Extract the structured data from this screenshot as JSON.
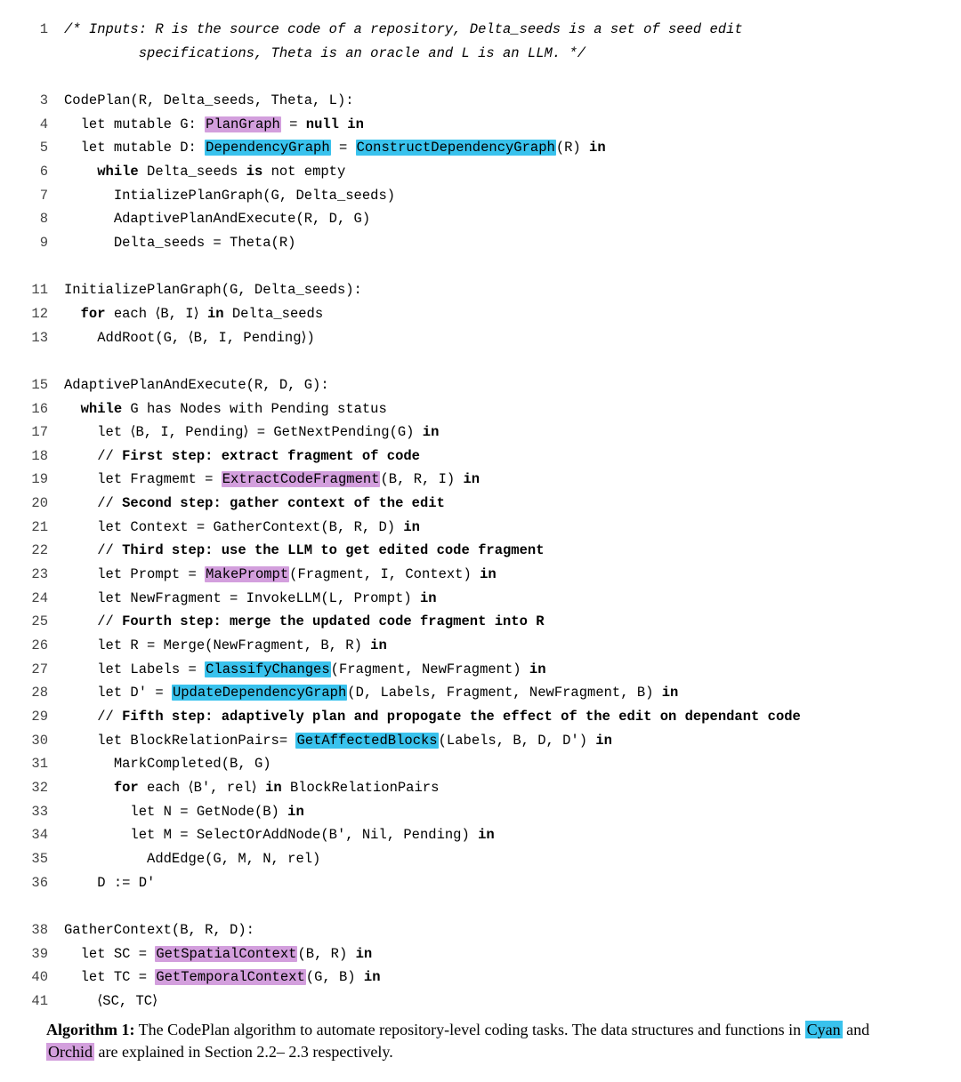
{
  "lines": [
    {
      "n": "1",
      "frags": [
        {
          "cls": "comment-ital",
          "t": "/* Inputs: R is the source code of a repository, Delta_seeds is a set of seed edit"
        }
      ]
    },
    {
      "n": "",
      "pad": "         ",
      "frags": [
        {
          "cls": "comment-ital",
          "t": "specifications, Theta is an oracle and L is an LLM. */"
        }
      ]
    },
    {
      "n": "",
      "frags": []
    },
    {
      "n": "3",
      "frags": [
        {
          "t": "CodePlan(R, Delta_seeds, Theta, L):"
        }
      ]
    },
    {
      "n": "4",
      "pad": "  ",
      "frags": [
        {
          "t": "let mutable G: "
        },
        {
          "cls": "hl-orchid",
          "t": "PlanGraph"
        },
        {
          "t": " = "
        },
        {
          "cls": "kw",
          "t": "null in"
        }
      ]
    },
    {
      "n": "5",
      "pad": "  ",
      "frags": [
        {
          "t": "let mutable D: "
        },
        {
          "cls": "hl-cyan",
          "t": "DependencyGraph"
        },
        {
          "t": " = "
        },
        {
          "cls": "hl-cyan",
          "t": "ConstructDependencyGraph"
        },
        {
          "t": "(R) "
        },
        {
          "cls": "kw",
          "t": "in"
        }
      ]
    },
    {
      "n": "6",
      "pad": "    ",
      "frags": [
        {
          "cls": "kw",
          "t": "while"
        },
        {
          "t": " Delta_seeds "
        },
        {
          "cls": "kw",
          "t": "is"
        },
        {
          "t": " not empty"
        }
      ]
    },
    {
      "n": "7",
      "pad": "      ",
      "frags": [
        {
          "t": "IntializePlanGraph(G, Delta_seeds)"
        }
      ]
    },
    {
      "n": "8",
      "pad": "      ",
      "frags": [
        {
          "t": "AdaptivePlanAndExecute(R, D, G)"
        }
      ]
    },
    {
      "n": "9",
      "pad": "      ",
      "frags": [
        {
          "t": "Delta_seeds = Theta(R)"
        }
      ]
    },
    {
      "n": "",
      "frags": []
    },
    {
      "n": "11",
      "frags": [
        {
          "t": "InitializePlanGraph(G, Delta_seeds):"
        }
      ]
    },
    {
      "n": "12",
      "pad": "  ",
      "frags": [
        {
          "cls": "kw",
          "t": "for"
        },
        {
          "t": " each ⟨B, I⟩ "
        },
        {
          "cls": "kw",
          "t": "in"
        },
        {
          "t": " Delta_seeds"
        }
      ]
    },
    {
      "n": "13",
      "pad": "    ",
      "frags": [
        {
          "t": "AddRoot(G, ⟨B, I, Pending⟩)"
        }
      ]
    },
    {
      "n": "",
      "frags": []
    },
    {
      "n": "15",
      "frags": [
        {
          "t": "AdaptivePlanAndExecute(R, D, G):"
        }
      ]
    },
    {
      "n": "16",
      "pad": "  ",
      "frags": [
        {
          "cls": "kw",
          "t": "while"
        },
        {
          "t": " G has Nodes with Pending status"
        }
      ]
    },
    {
      "n": "17",
      "pad": "    ",
      "frags": [
        {
          "t": "let ⟨B, I, Pending⟩ = GetNextPending(G) "
        },
        {
          "cls": "kw",
          "t": "in"
        }
      ]
    },
    {
      "n": "18",
      "pad": "    ",
      "frags": [
        {
          "t": "// "
        },
        {
          "cls": "kw",
          "t": "First step: extract fragment of code"
        }
      ]
    },
    {
      "n": "19",
      "pad": "    ",
      "frags": [
        {
          "t": "let Fragmemt = "
        },
        {
          "cls": "hl-orchid",
          "t": "ExtractCodeFragment"
        },
        {
          "t": "(B, R, I) "
        },
        {
          "cls": "kw",
          "t": "in"
        }
      ]
    },
    {
      "n": "20",
      "pad": "    ",
      "frags": [
        {
          "t": "// "
        },
        {
          "cls": "kw",
          "t": "Second step: gather context of the edit"
        }
      ]
    },
    {
      "n": "21",
      "pad": "    ",
      "frags": [
        {
          "t": "let Context = GatherContext(B, R, D) "
        },
        {
          "cls": "kw",
          "t": "in"
        }
      ]
    },
    {
      "n": "22",
      "pad": "    ",
      "frags": [
        {
          "t": "// "
        },
        {
          "cls": "kw",
          "t": "Third step: use the LLM to get edited code fragment"
        }
      ]
    },
    {
      "n": "23",
      "pad": "    ",
      "frags": [
        {
          "t": "let Prompt = "
        },
        {
          "cls": "hl-orchid",
          "t": "MakePrompt"
        },
        {
          "t": "(Fragment, I, Context) "
        },
        {
          "cls": "kw",
          "t": "in"
        }
      ]
    },
    {
      "n": "24",
      "pad": "    ",
      "frags": [
        {
          "t": "let NewFragment = InvokeLLM(L, Prompt) "
        },
        {
          "cls": "kw",
          "t": "in"
        }
      ]
    },
    {
      "n": "25",
      "pad": "    ",
      "frags": [
        {
          "t": "// "
        },
        {
          "cls": "kw",
          "t": "Fourth step: merge the updated code fragment into R"
        }
      ]
    },
    {
      "n": "26",
      "pad": "    ",
      "frags": [
        {
          "t": "let R = Merge(NewFragment, B, R) "
        },
        {
          "cls": "kw",
          "t": "in"
        }
      ]
    },
    {
      "n": "27",
      "pad": "    ",
      "frags": [
        {
          "t": "let Labels = "
        },
        {
          "cls": "hl-cyan",
          "t": "ClassifyChanges"
        },
        {
          "t": "(Fragment, NewFragment) "
        },
        {
          "cls": "kw",
          "t": "in"
        }
      ]
    },
    {
      "n": "28",
      "pad": "    ",
      "frags": [
        {
          "t": "let D' = "
        },
        {
          "cls": "hl-cyan",
          "t": "UpdateDependencyGraph"
        },
        {
          "t": "(D, Labels, Fragment, NewFragment, B) "
        },
        {
          "cls": "kw",
          "t": "in"
        }
      ]
    },
    {
      "n": "29",
      "pad": "    ",
      "frags": [
        {
          "t": "// "
        },
        {
          "cls": "kw",
          "t": "Fifth step: adaptively plan and propogate the effect of the edit on dependant code"
        }
      ]
    },
    {
      "n": "30",
      "pad": "    ",
      "frags": [
        {
          "t": "let BlockRelationPairs= "
        },
        {
          "cls": "hl-cyan",
          "t": "GetAffectedBlocks"
        },
        {
          "t": "(Labels, B, D, D') "
        },
        {
          "cls": "kw",
          "t": "in"
        }
      ]
    },
    {
      "n": "31",
      "pad": "      ",
      "frags": [
        {
          "t": "MarkCompleted(B, G)"
        }
      ]
    },
    {
      "n": "32",
      "pad": "      ",
      "frags": [
        {
          "cls": "kw",
          "t": "for"
        },
        {
          "t": " each ⟨B′, rel⟩ "
        },
        {
          "cls": "kw",
          "t": "in"
        },
        {
          "t": " BlockRelationPairs"
        }
      ]
    },
    {
      "n": "33",
      "pad": "        ",
      "frags": [
        {
          "t": "let N = GetNode(B) "
        },
        {
          "cls": "kw",
          "t": "in"
        }
      ]
    },
    {
      "n": "34",
      "pad": "        ",
      "frags": [
        {
          "t": "let M = SelectOrAddNode(B', Nil, Pending) "
        },
        {
          "cls": "kw",
          "t": "in"
        }
      ]
    },
    {
      "n": "35",
      "pad": "          ",
      "frags": [
        {
          "t": "AddEdge(G, M, N, rel)"
        }
      ]
    },
    {
      "n": "36",
      "pad": "    ",
      "frags": [
        {
          "t": "D := D'"
        }
      ]
    },
    {
      "n": "",
      "frags": []
    },
    {
      "n": "38",
      "frags": [
        {
          "t": "GatherContext(B, R, D):"
        }
      ]
    },
    {
      "n": "39",
      "pad": "  ",
      "frags": [
        {
          "t": "let SC = "
        },
        {
          "cls": "hl-orchid",
          "t": "GetSpatialContext"
        },
        {
          "t": "(B, R) "
        },
        {
          "cls": "kw",
          "t": "in"
        }
      ]
    },
    {
      "n": "40",
      "pad": "  ",
      "frags": [
        {
          "t": "let TC = "
        },
        {
          "cls": "hl-orchid",
          "t": "GetTemporalContext"
        },
        {
          "t": "(G, B) "
        },
        {
          "cls": "kw",
          "t": "in"
        }
      ]
    },
    {
      "n": "41",
      "pad": "    ",
      "frags": [
        {
          "t": "⟨SC, TC⟩"
        }
      ]
    }
  ],
  "caption": {
    "label": "Algorithm 1:",
    "pre": " The CodePlan algorithm to automate repository-level coding tasks. The data structures and functions in ",
    "cyan": "Cyan",
    "mid": " and ",
    "orchid": "Orchid",
    "post": " are explained in Section 2.2– 2.3 respectively."
  }
}
